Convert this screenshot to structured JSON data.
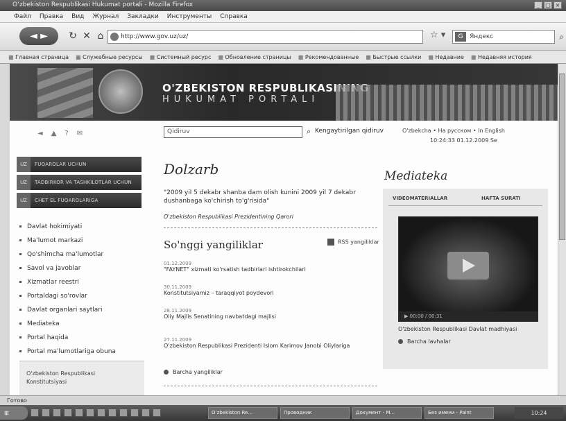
{
  "browser": {
    "window_title": "Oʻzbekiston Respublikasi Hukumat portali - Mozilla Firefox",
    "menu": [
      "Файл",
      "Правка",
      "Вид",
      "Журнал",
      "Закладки",
      "Инструменты",
      "Справка"
    ],
    "address": "http://www.gov.uz/uz/",
    "search_engine_label": "Google",
    "search_placeholder": "Яндекс",
    "bookmarks": [
      "Главная страница",
      "Служебные ресурсы",
      "Системный ресурс",
      "Обновление страницы",
      "Рекомендованные",
      "Быстрые ссылки",
      "Недавние",
      "Недавняя история"
    ],
    "status_text": "Готово",
    "taskbar_tasks": [
      "Oʻzbekiston Re...",
      "Проводник",
      "Документ - M...",
      "Без имени - Paint"
    ],
    "tray_time": "10:24"
  },
  "banner": {
    "title": "O'ZBEKISTON RESPUBLIKASINING",
    "subtitle": "HUKUMAT PORTALI"
  },
  "tools": [
    "◄",
    "▲",
    "?",
    "✉"
  ],
  "site_search": {
    "placeholder": "Qidiruv",
    "advanced": "Kengaytirilgan qidiruv"
  },
  "languages": "O'zbekcha  •  На русском  •  In English",
  "datetime": "10:24:33   01.12.2009 Se",
  "left_menu": {
    "dark_items": [
      {
        "abbr": "UZ",
        "label": "FUQAROLAR UCHUN"
      },
      {
        "abbr": "UZ",
        "label": "TADBIRKOR VA TASHKILOTLAR UCHUN"
      },
      {
        "abbr": "UZ",
        "label": "CHET EL FUQAROLARIGA"
      }
    ],
    "links": [
      "Davlat hokimiyati",
      "Ma'lumot markazi",
      "Qo'shimcha ma'lumotlar",
      "Savol va javoblar",
      "Xizmatlar reestri",
      "Portaldagi so'rovlar",
      "Davlat organlari saytlari",
      "Mediateka",
      "Portal haqida",
      "Portal ma'lumotlariga obuna"
    ],
    "footer": "O'zbekiston Respublikasi Konstitutsiyasi"
  },
  "main": {
    "heading": "Dolzarb",
    "quote": "\"2009 yil 5 dekabr shanba dam olish kunini 2009 yil 7 dekabr dushanbaga ko'chirish to'g'risida\"",
    "quote_source": "O'zbekiston Respublikasi Prezidentining Qarori",
    "news_heading": "So'nggi yangiliklar",
    "rss_label": "RSS yangiliklar",
    "news": [
      {
        "date": "01.12.2009",
        "title": "\"FAYNET\" xizmati ko'rsatish tadbirlari ishtirokchilari"
      },
      {
        "date": "30.11.2009",
        "title": "Konstitutsiyamiz – taraqqiyot poydevori"
      },
      {
        "date": "28.11.2009",
        "title": "Oliy Majlis Senatining navbatdagi majlisi"
      },
      {
        "date": "27.11.2009",
        "title": "O'zbekiston Respublikasi Prezidenti Islom Karimov Janobi Oliylariga"
      }
    ],
    "all_news": "Barcha yangiliklar"
  },
  "mediateka": {
    "heading": "Mediateka",
    "tabs": [
      "VIDEOMATERIALLAR",
      "HAFTA SURATI"
    ],
    "video_time": "00:00 / 00:31",
    "caption": "O'zbekiston Respublikasi Davlat madhiyasi",
    "more": "Barcha lavhalar"
  }
}
